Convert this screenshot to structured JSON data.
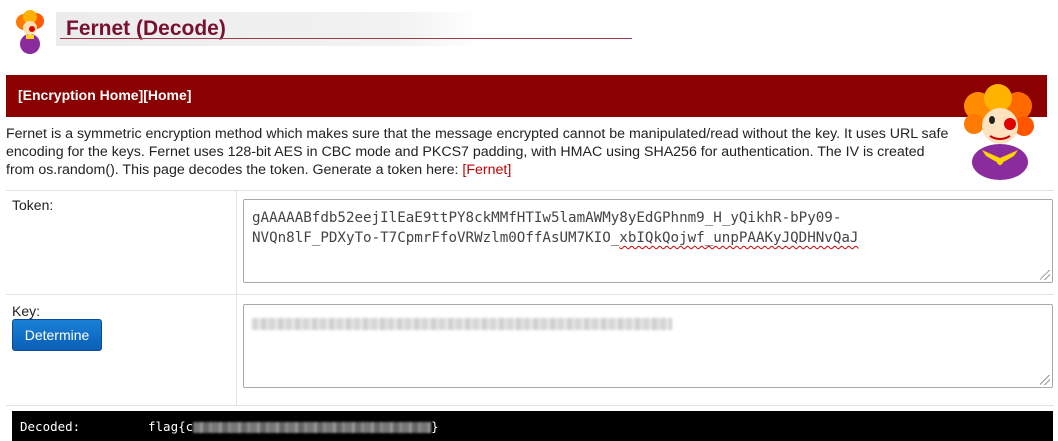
{
  "header": {
    "title": "Fernet (Decode)",
    "icon": "clown-icon"
  },
  "nav": {
    "encryption_home": "[Encryption Home]",
    "home": "[Home]"
  },
  "description": {
    "text": "Fernet is a symmetric encryption method which makes sure that the message encrypted cannot be manipulated/read without the key. It uses URL safe encoding for the keys. Fernet uses 128-bit AES in CBC mode and PKCS7 padding, with HMAC using SHA256 for authentication. The IV is created from os.random(). This page decodes the token. Generate a token here: ",
    "link_text": "[Fernet]"
  },
  "form": {
    "token_label": "Token:",
    "token_line1": "gAAAAABfdb52eejIlEaE9ttPY8ckMMfHTIw5lamAWMy8yEdGPhnm9_H_yQikhR-bPy09-",
    "token_line2_a": "NVQn8lF_PDXyTo-T7CpmrFfoVRWzlm0OffAsUM7KIO_",
    "token_line2_b": "xbIQkQojwf_unpPAAKyJQDHNvQaJ",
    "key_label": "Key:",
    "determine_button": "Determine"
  },
  "output": {
    "label": "Decoded:",
    "value_prefix": "flag{c",
    "value_suffix": "}"
  },
  "colors": {
    "navbar": "#8b0000",
    "title": "#7a1030",
    "button": "#0a5fb5",
    "link": "#c00000"
  }
}
